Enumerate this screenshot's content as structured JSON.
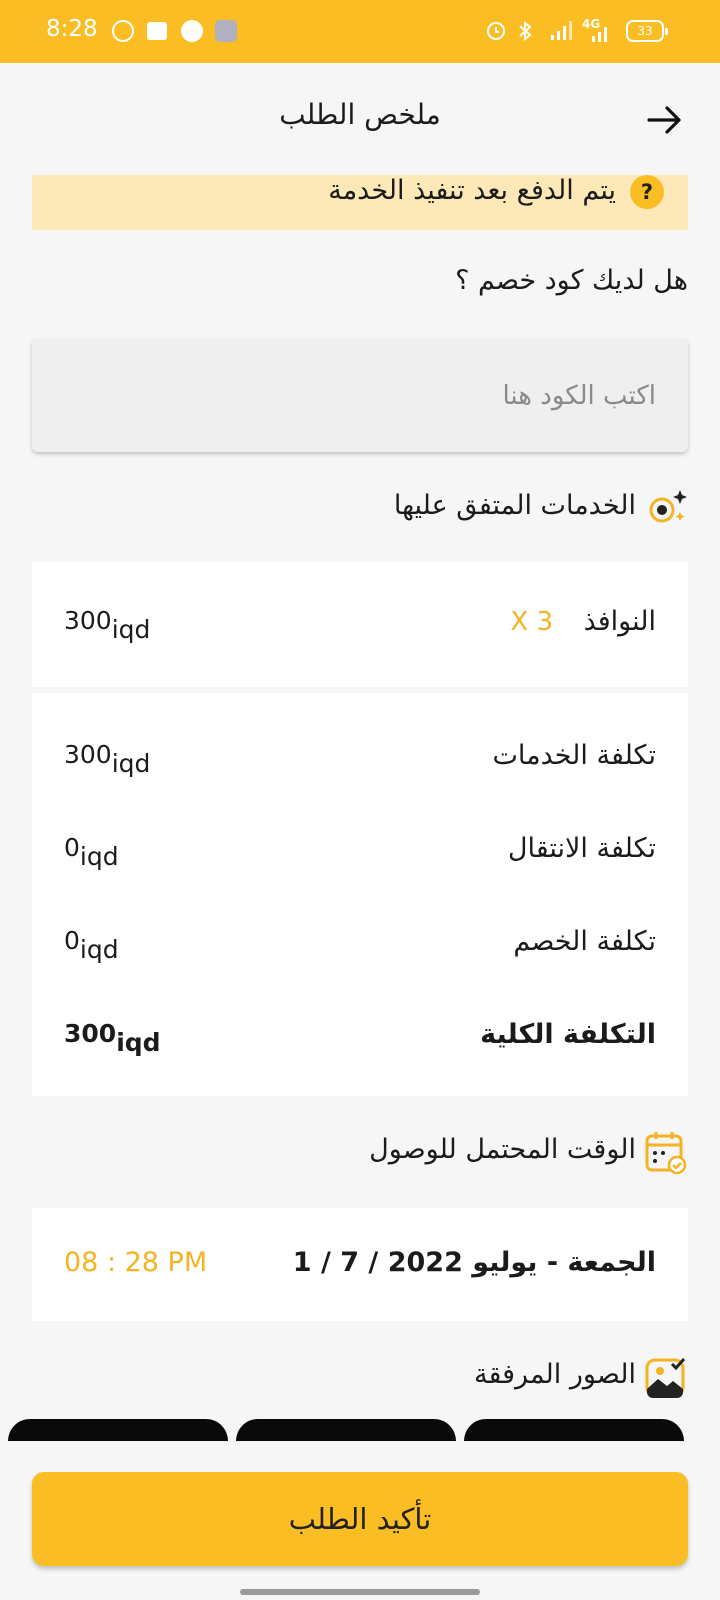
{
  "status_bar": {
    "time": "8:28",
    "battery": "33",
    "network": "4G"
  },
  "header": {
    "title": "ملخص الطلب"
  },
  "notice": {
    "text": "يتم الدفع بعد تنفيذ الخدمة"
  },
  "discount": {
    "question": "هل لديك كود خصم ؟",
    "placeholder": "اكتب الكود هنا"
  },
  "services": {
    "title": "الخدمات المتفق عليها",
    "item": {
      "name": "النوافذ",
      "quantity": "X 3",
      "amount": "300",
      "currency": "iqd"
    }
  },
  "costs": {
    "currency": "iqd",
    "rows": [
      {
        "label": "تكلفة الخدمات",
        "amount": "300"
      },
      {
        "label": "تكلفة الانتقال",
        "amount": "0"
      },
      {
        "label": "تكلفة الخصم",
        "amount": "0"
      },
      {
        "label": "التكلفة الكلية",
        "amount": "300"
      }
    ]
  },
  "arrival": {
    "title": "الوقت المحتمل للوصول",
    "date": "الجمعة - يوليو 2022 / 7 / 1",
    "time": "08 : 28 PM"
  },
  "attachments": {
    "title": "الصور المرفقة"
  },
  "confirm": {
    "label": "تأكيد الطلب"
  },
  "colors": {
    "accent": "#fbbd24",
    "notice_bg": "#fde9b8",
    "value_accent": "#f5b324"
  }
}
